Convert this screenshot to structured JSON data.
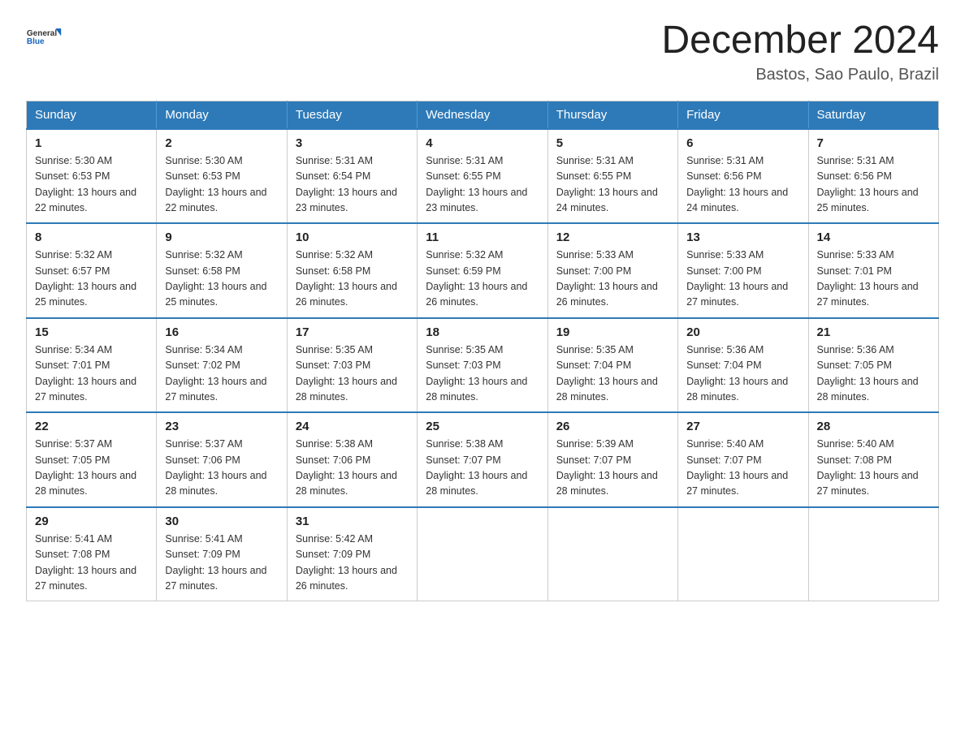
{
  "header": {
    "logo_general": "General",
    "logo_blue": "Blue",
    "month_title": "December 2024",
    "location": "Bastos, Sao Paulo, Brazil"
  },
  "days_of_week": [
    "Sunday",
    "Monday",
    "Tuesday",
    "Wednesday",
    "Thursday",
    "Friday",
    "Saturday"
  ],
  "weeks": [
    [
      {
        "day": "1",
        "sunrise": "5:30 AM",
        "sunset": "6:53 PM",
        "daylight": "13 hours and 22 minutes."
      },
      {
        "day": "2",
        "sunrise": "5:30 AM",
        "sunset": "6:53 PM",
        "daylight": "13 hours and 22 minutes."
      },
      {
        "day": "3",
        "sunrise": "5:31 AM",
        "sunset": "6:54 PM",
        "daylight": "13 hours and 23 minutes."
      },
      {
        "day": "4",
        "sunrise": "5:31 AM",
        "sunset": "6:55 PM",
        "daylight": "13 hours and 23 minutes."
      },
      {
        "day": "5",
        "sunrise": "5:31 AM",
        "sunset": "6:55 PM",
        "daylight": "13 hours and 24 minutes."
      },
      {
        "day": "6",
        "sunrise": "5:31 AM",
        "sunset": "6:56 PM",
        "daylight": "13 hours and 24 minutes."
      },
      {
        "day": "7",
        "sunrise": "5:31 AM",
        "sunset": "6:56 PM",
        "daylight": "13 hours and 25 minutes."
      }
    ],
    [
      {
        "day": "8",
        "sunrise": "5:32 AM",
        "sunset": "6:57 PM",
        "daylight": "13 hours and 25 minutes."
      },
      {
        "day": "9",
        "sunrise": "5:32 AM",
        "sunset": "6:58 PM",
        "daylight": "13 hours and 25 minutes."
      },
      {
        "day": "10",
        "sunrise": "5:32 AM",
        "sunset": "6:58 PM",
        "daylight": "13 hours and 26 minutes."
      },
      {
        "day": "11",
        "sunrise": "5:32 AM",
        "sunset": "6:59 PM",
        "daylight": "13 hours and 26 minutes."
      },
      {
        "day": "12",
        "sunrise": "5:33 AM",
        "sunset": "7:00 PM",
        "daylight": "13 hours and 26 minutes."
      },
      {
        "day": "13",
        "sunrise": "5:33 AM",
        "sunset": "7:00 PM",
        "daylight": "13 hours and 27 minutes."
      },
      {
        "day": "14",
        "sunrise": "5:33 AM",
        "sunset": "7:01 PM",
        "daylight": "13 hours and 27 minutes."
      }
    ],
    [
      {
        "day": "15",
        "sunrise": "5:34 AM",
        "sunset": "7:01 PM",
        "daylight": "13 hours and 27 minutes."
      },
      {
        "day": "16",
        "sunrise": "5:34 AM",
        "sunset": "7:02 PM",
        "daylight": "13 hours and 27 minutes."
      },
      {
        "day": "17",
        "sunrise": "5:35 AM",
        "sunset": "7:03 PM",
        "daylight": "13 hours and 28 minutes."
      },
      {
        "day": "18",
        "sunrise": "5:35 AM",
        "sunset": "7:03 PM",
        "daylight": "13 hours and 28 minutes."
      },
      {
        "day": "19",
        "sunrise": "5:35 AM",
        "sunset": "7:04 PM",
        "daylight": "13 hours and 28 minutes."
      },
      {
        "day": "20",
        "sunrise": "5:36 AM",
        "sunset": "7:04 PM",
        "daylight": "13 hours and 28 minutes."
      },
      {
        "day": "21",
        "sunrise": "5:36 AM",
        "sunset": "7:05 PM",
        "daylight": "13 hours and 28 minutes."
      }
    ],
    [
      {
        "day": "22",
        "sunrise": "5:37 AM",
        "sunset": "7:05 PM",
        "daylight": "13 hours and 28 minutes."
      },
      {
        "day": "23",
        "sunrise": "5:37 AM",
        "sunset": "7:06 PM",
        "daylight": "13 hours and 28 minutes."
      },
      {
        "day": "24",
        "sunrise": "5:38 AM",
        "sunset": "7:06 PM",
        "daylight": "13 hours and 28 minutes."
      },
      {
        "day": "25",
        "sunrise": "5:38 AM",
        "sunset": "7:07 PM",
        "daylight": "13 hours and 28 minutes."
      },
      {
        "day": "26",
        "sunrise": "5:39 AM",
        "sunset": "7:07 PM",
        "daylight": "13 hours and 28 minutes."
      },
      {
        "day": "27",
        "sunrise": "5:40 AM",
        "sunset": "7:07 PM",
        "daylight": "13 hours and 27 minutes."
      },
      {
        "day": "28",
        "sunrise": "5:40 AM",
        "sunset": "7:08 PM",
        "daylight": "13 hours and 27 minutes."
      }
    ],
    [
      {
        "day": "29",
        "sunrise": "5:41 AM",
        "sunset": "7:08 PM",
        "daylight": "13 hours and 27 minutes."
      },
      {
        "day": "30",
        "sunrise": "5:41 AM",
        "sunset": "7:09 PM",
        "daylight": "13 hours and 27 minutes."
      },
      {
        "day": "31",
        "sunrise": "5:42 AM",
        "sunset": "7:09 PM",
        "daylight": "13 hours and 26 minutes."
      },
      null,
      null,
      null,
      null
    ]
  ],
  "labels": {
    "sunrise_prefix": "Sunrise: ",
    "sunset_prefix": "Sunset: ",
    "daylight_prefix": "Daylight: "
  }
}
